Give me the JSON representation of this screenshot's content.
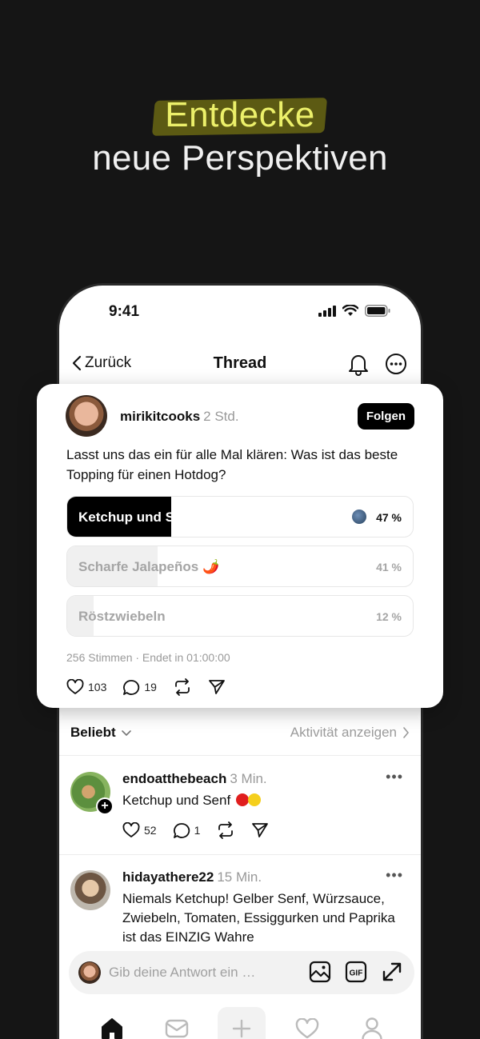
{
  "promo": {
    "line1": "Entdecke",
    "line2": "neue Perspektiven",
    "highlight_color": "#ECF06A"
  },
  "status_bar": {
    "time": "9:41"
  },
  "nav": {
    "back_label": "Zurück",
    "title": "Thread",
    "icons": [
      "chevron-left-icon",
      "bell-icon",
      "more-circle-icon"
    ]
  },
  "post": {
    "username": "mirikitcooks",
    "time": "2 Std.",
    "follow_label": "Folgen",
    "text": "Lasst uns das ein für alle Mal klären: Was ist das beste Topping für einen Hotdog?",
    "poll": {
      "options": [
        {
          "label": "Ketchup und Senf",
          "percent_label": "47 %",
          "value": 47,
          "selected": true
        },
        {
          "label": "Scharfe Jalapeños 🌶️",
          "percent_label": "41 %",
          "value": 41,
          "selected": false
        },
        {
          "label": "Röstzwiebeln",
          "percent_label": "12 %",
          "value": 12,
          "selected": false
        }
      ],
      "meta": "256 Stimmen · Endet in 01:00:00"
    },
    "actions": {
      "likes": "103",
      "comments": "19"
    }
  },
  "sort": {
    "label": "Beliebt",
    "activity_link": "Aktivität anzeigen"
  },
  "replies": [
    {
      "username": "endoatthebeach",
      "time": "3 Min.",
      "text": "Ketchup und Senf",
      "likes": "52",
      "comments": "1"
    },
    {
      "username": "hidayathere22",
      "time": "15 Min.",
      "text": "Niemals Ketchup! Gelber Senf, Würzsauce, Zwiebeln, Tomaten, Essiggurken und Paprika ist das EINZIG Wahre"
    }
  ],
  "composer": {
    "placeholder": "Gib deine Antwort ein …",
    "icons": [
      "image-icon",
      "gif-icon",
      "expand-icon"
    ]
  },
  "tabbar": {
    "icons": [
      "home-icon",
      "inbox-icon",
      "plus-icon",
      "heart-icon",
      "profile-icon"
    ]
  }
}
